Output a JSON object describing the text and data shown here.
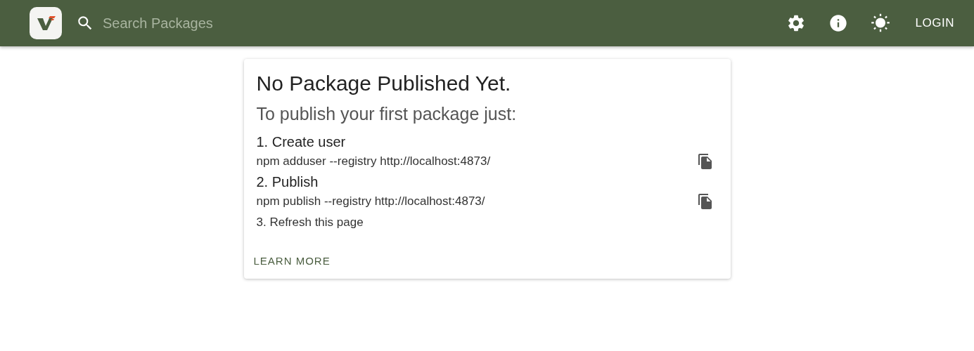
{
  "header": {
    "search": {
      "placeholder": "Search Packages"
    },
    "login": "LOGIN"
  },
  "card": {
    "title": "No Package Published Yet.",
    "subtitle": "To publish your first package just:",
    "steps": [
      {
        "kind": "step",
        "text": "1. Create user"
      },
      {
        "kind": "command",
        "text": "npm adduser --registry http://localhost:4873/"
      },
      {
        "kind": "step",
        "text": "2. Publish"
      },
      {
        "kind": "command",
        "text": "npm publish --registry http://localhost:4873/"
      },
      {
        "kind": "note",
        "text": "3. Refresh this page"
      }
    ],
    "link": "LEARN MORE"
  }
}
